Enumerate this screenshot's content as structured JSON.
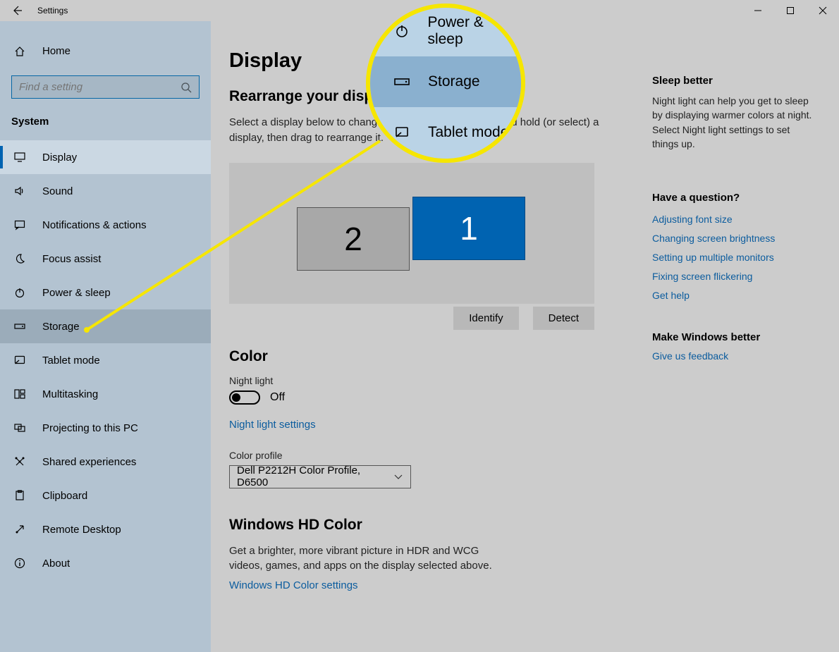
{
  "window": {
    "title": "Settings"
  },
  "sidebar": {
    "home": "Home",
    "search_placeholder": "Find a setting",
    "section": "System",
    "items": [
      {
        "label": "Display",
        "icon": "monitor-icon",
        "state": "active"
      },
      {
        "label": "Sound",
        "icon": "speaker-icon",
        "state": ""
      },
      {
        "label": "Notifications & actions",
        "icon": "chat-icon",
        "state": ""
      },
      {
        "label": "Focus assist",
        "icon": "moon-icon",
        "state": ""
      },
      {
        "label": "Power & sleep",
        "icon": "power-icon",
        "state": ""
      },
      {
        "label": "Storage",
        "icon": "drive-icon",
        "state": "highlight"
      },
      {
        "label": "Tablet mode",
        "icon": "tablet-icon",
        "state": ""
      },
      {
        "label": "Multitasking",
        "icon": "multitask-icon",
        "state": ""
      },
      {
        "label": "Projecting to this PC",
        "icon": "project-icon",
        "state": ""
      },
      {
        "label": "Shared experiences",
        "icon": "share-icon",
        "state": ""
      },
      {
        "label": "Clipboard",
        "icon": "clipboard-icon",
        "state": ""
      },
      {
        "label": "Remote Desktop",
        "icon": "remote-icon",
        "state": ""
      },
      {
        "label": "About",
        "icon": "info-icon",
        "state": ""
      }
    ]
  },
  "main": {
    "title": "Display",
    "rearrange_heading": "Rearrange your displays",
    "rearrange_desc": "Select a display below to change the settings for it. Press and hold (or select) a display, then drag to rearrange it.",
    "display2": "2",
    "display1": "1",
    "identify": "Identify",
    "detect": "Detect",
    "color_heading": "Color",
    "night_light_label": "Night light",
    "night_light_state": "Off",
    "night_light_link": "Night light settings",
    "color_profile_label": "Color profile",
    "color_profile_value": "Dell P2212H Color Profile, D6500",
    "hdcolor_heading": "Windows HD Color",
    "hdcolor_desc": "Get a brighter, more vibrant picture in HDR and WCG videos, games, and apps on the display selected above.",
    "hdcolor_link": "Windows HD Color settings"
  },
  "side": {
    "sleep_title": "Sleep better",
    "sleep_body": "Night light can help you get to sleep by displaying warmer colors at night. Select Night light settings to set things up.",
    "question_title": "Have a question?",
    "links": [
      "Adjusting font size",
      "Changing screen brightness",
      "Setting up multiple monitors",
      "Fixing screen flickering",
      "Get help"
    ],
    "better_title": "Make Windows better",
    "feedback": "Give us feedback"
  },
  "magnifier": {
    "row0": "Power & sleep",
    "row1": "Storage",
    "row2": "Tablet mode"
  },
  "icons": {
    "home": "⌂",
    "monitor": "🖵",
    "speaker": "🕪",
    "chat": "💬",
    "moon": "☽",
    "power": "⏻",
    "drive": "▭",
    "tablet": "⌧",
    "multitask": "▥",
    "project": "⧉",
    "share": "✂",
    "clipboard": "📋",
    "remote": "↗",
    "info": "ⓘ"
  }
}
